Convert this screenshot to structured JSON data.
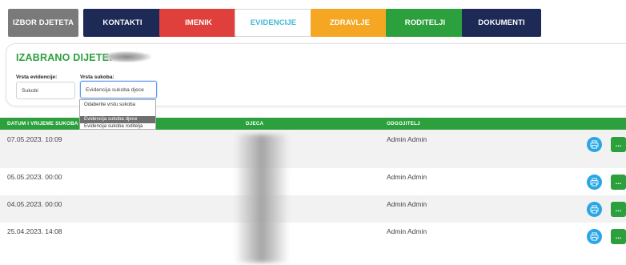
{
  "tabs": [
    {
      "label": "IZBOR DJETETA",
      "color": "#7a7a7a"
    },
    {
      "label": "KONTAKTI",
      "color": "#1c2a55"
    },
    {
      "label": "IMENIK",
      "color": "#e0403c"
    },
    {
      "label": "EVIDENCIJE",
      "color": "#ffffff"
    },
    {
      "label": "ZDRAVLJE",
      "color": "#f5a623"
    },
    {
      "label": "RODITELJI",
      "color": "#2ca03c"
    },
    {
      "label": "DOKUMENTI",
      "color": "#1c2a55"
    }
  ],
  "active_tab": "EVIDENCIJE",
  "selection": {
    "title": "IZABRANO DIJETE:",
    "vrsta_evidencije_label": "Vrsta evidencije:",
    "vrsta_evidencije_value": "Sukobi",
    "vrsta_sukoba_label": "Vrsta sukoba:",
    "vrsta_sukoba_value": "Evidencija sukoba djece",
    "options": [
      "Odaberite vrstu sukoba",
      "Evidencija sukoba djece",
      "Evidencija sukoba roditelja"
    ],
    "selected_option": "Evidencija sukoba djece"
  },
  "table": {
    "headers": [
      "DATUM I VRIJEME SUKOBA",
      "DJECA",
      "ODGOJITELJ"
    ],
    "rows": [
      {
        "datetime": "07.05.2023. 10:09",
        "odgojitelj": "Admin Admin"
      },
      {
        "datetime": "05.05.2023. 00:00",
        "odgojitelj": "Admin Admin"
      },
      {
        "datetime": "04.05.2023. 00:00",
        "odgojitelj": "Admin Admin"
      },
      {
        "datetime": "25.04.2023. 14:08",
        "odgojitelj": "Admin Admin"
      }
    ],
    "more_label": "..."
  },
  "colors": {
    "header_green": "#2ca03c",
    "title_green": "#2ca03c",
    "print_blue": "#29a6e6",
    "active_tab_text": "#3fb6d9"
  }
}
